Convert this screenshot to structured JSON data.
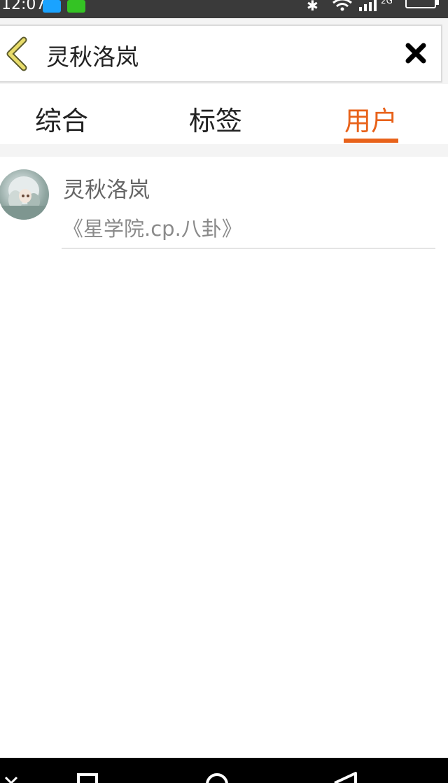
{
  "status_bar": {
    "time": "12:07",
    "icons": [
      "qq-icon",
      "wechat-icon",
      "bluetooth-icon",
      "wifi-icon",
      "signal-icon",
      "battery-icon"
    ],
    "network_label": "2G"
  },
  "search": {
    "query": "灵秋洛岚",
    "back_icon": "chevron-left-icon",
    "clear_icon": "close-icon"
  },
  "tabs": [
    {
      "label": "综合",
      "active": false
    },
    {
      "label": "标签",
      "active": false
    },
    {
      "label": "用户",
      "active": true
    }
  ],
  "results": [
    {
      "name": "灵秋洛岚",
      "signature": "《星学院.cp.八卦》"
    }
  ],
  "nav_bar": {
    "icons": [
      "hide-keyboard-icon",
      "recent-apps-icon",
      "home-icon",
      "back-icon"
    ]
  },
  "colors": {
    "accent": "#e8621a",
    "status_bar": "#3a3a3a",
    "background": "#f4f4f4"
  }
}
